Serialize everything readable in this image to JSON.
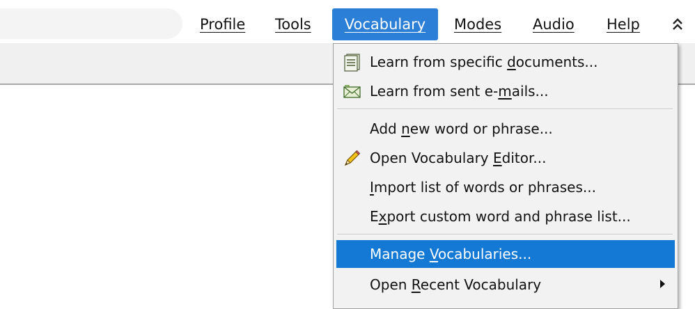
{
  "menubar": {
    "items": [
      {
        "label": "Profile",
        "active": false
      },
      {
        "label": "Tools",
        "active": false
      },
      {
        "label": "Vocabulary",
        "active": true
      },
      {
        "label": "Modes",
        "active": false
      },
      {
        "label": "Audio",
        "active": false
      },
      {
        "label": "Help",
        "active": false
      }
    ],
    "collapse_icon": "double-chevron-up-icon"
  },
  "vocabulary_menu": {
    "items": [
      {
        "pre": "Learn from specific ",
        "key": "d",
        "post": "ocuments...",
        "icon": "document-icon"
      },
      {
        "pre": "Learn from sent e-",
        "key": "m",
        "post": "ails...",
        "icon": "envelope-icon"
      },
      {
        "pre": "Add ",
        "key": "n",
        "post": "ew word or phrase...",
        "icon": ""
      },
      {
        "pre": "Open Vocabulary ",
        "key": "E",
        "post": "ditor...",
        "icon": "pencil-icon"
      },
      {
        "pre": "",
        "key": "I",
        "post": "mport list of words or phrases...",
        "icon": ""
      },
      {
        "pre": "E",
        "key": "x",
        "post": "port custom word and phrase list...",
        "icon": ""
      },
      {
        "pre": "Manage ",
        "key": "V",
        "post": "ocabularies...",
        "icon": "",
        "highlighted": true
      },
      {
        "pre": "Open ",
        "key": "R",
        "post": "ecent Vocabulary",
        "icon": "",
        "submenu_icon": "submenu-arrow-icon"
      }
    ]
  },
  "colors": {
    "accent": "#1479d4",
    "menubar_active": "#2b7fd6",
    "menu_background": "#f2f2f2"
  }
}
